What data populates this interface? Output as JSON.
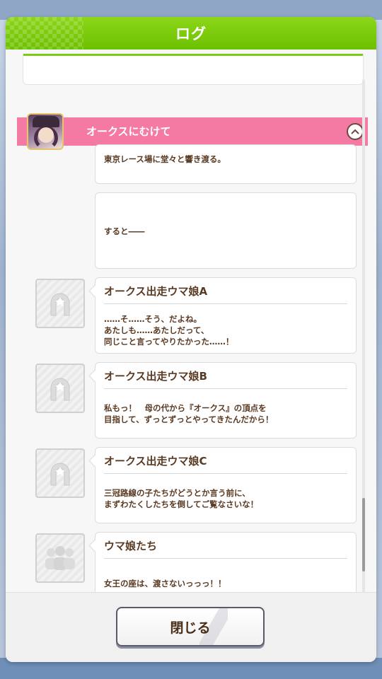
{
  "window": {
    "title": "ログ"
  },
  "chapter": {
    "title": "オークスにむけて",
    "toggle_icon": "chevron-up-icon"
  },
  "entries": [
    {
      "speaker": "",
      "text": "東京レース場に堂々と響き渡る。",
      "avatar": "none"
    },
    {
      "speaker": "",
      "text": "すると――",
      "avatar": "none"
    },
    {
      "speaker": "オークス出走ウマ娘A",
      "text": "……そ……そう、だよね。\nあたしも……あたしだって、\n同じこと言ってやりたかった……！",
      "avatar": "horseshoe-icon"
    },
    {
      "speaker": "オークス出走ウマ娘B",
      "text": "私もっ！　母の代から『オークス』の頂点を\n目指して、ずっとずっとやってきたんだから！",
      "avatar": "horseshoe-icon"
    },
    {
      "speaker": "オークス出走ウマ娘C",
      "text": "三冠路線の子たちがどうとか言う前に、\nまずわたくしたちを倒してご覧なさいな！",
      "avatar": "horseshoe-icon"
    },
    {
      "speaker": "ウマ娘たち",
      "text": "女王の座は、渡さないっっっ！！",
      "avatar": "group-icon"
    }
  ],
  "footer": {
    "close_label": "閉じる"
  },
  "colors": {
    "header": "#6cc100",
    "chapter_bar": "#f57aa3",
    "text": "#5a3a22"
  }
}
